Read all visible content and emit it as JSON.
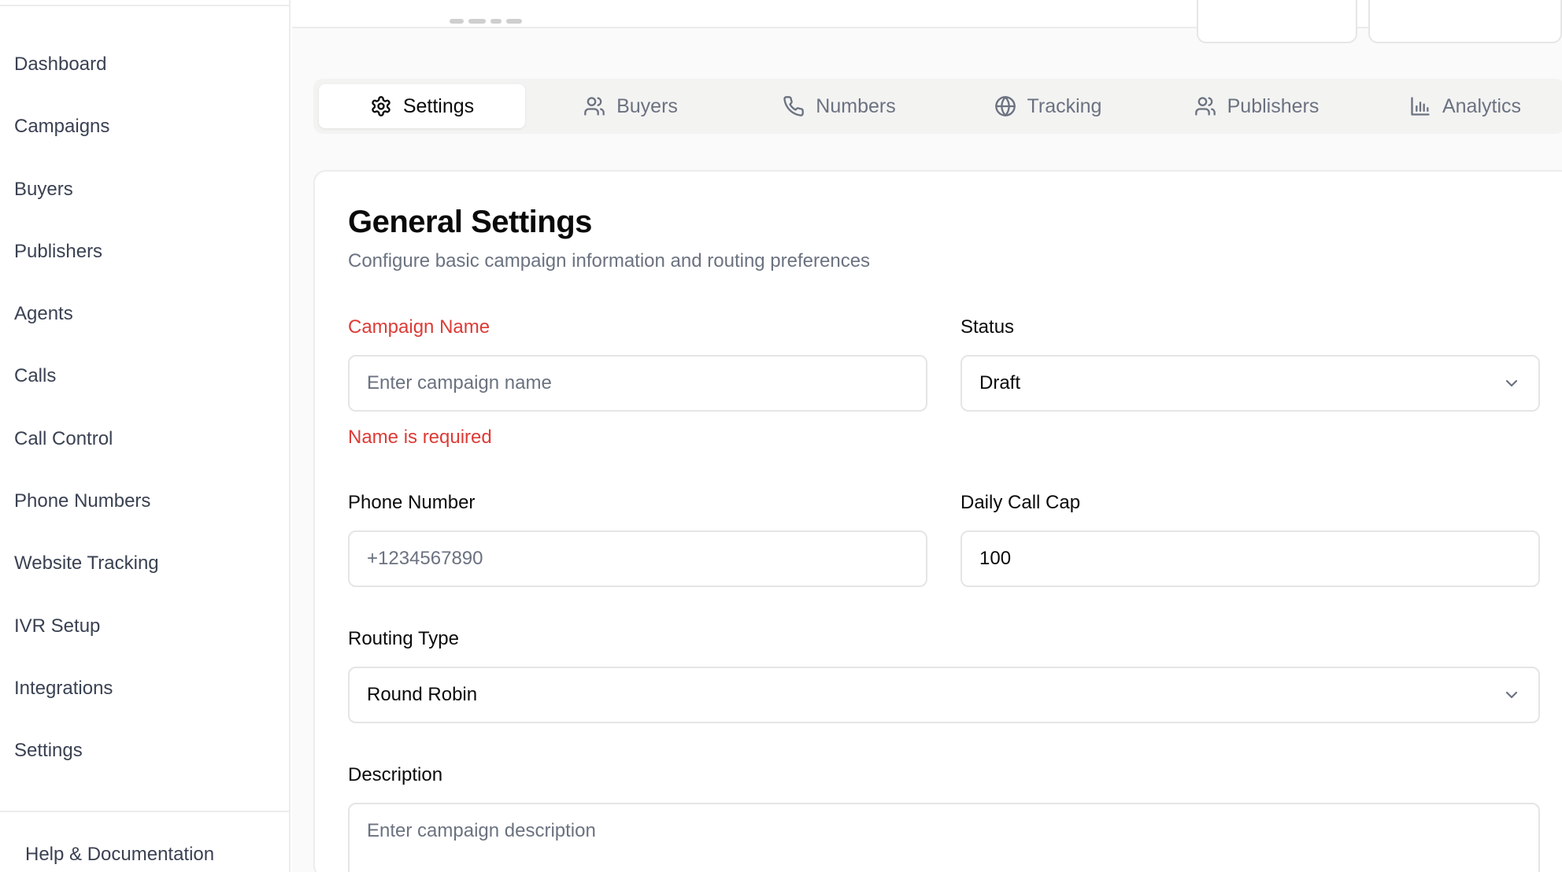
{
  "sidebar": {
    "items": [
      {
        "label": "Dashboard"
      },
      {
        "label": "Campaigns"
      },
      {
        "label": "Buyers"
      },
      {
        "label": "Publishers"
      },
      {
        "label": "Agents"
      },
      {
        "label": "Calls"
      },
      {
        "label": "Call Control"
      },
      {
        "label": "Phone Numbers"
      },
      {
        "label": "Website Tracking"
      },
      {
        "label": "IVR Setup"
      },
      {
        "label": "Integrations"
      },
      {
        "label": "Settings"
      }
    ],
    "footer_link": "Help & Documentation"
  },
  "tabs": [
    {
      "label": "Settings",
      "icon": "gear-icon",
      "active": true
    },
    {
      "label": "Buyers",
      "icon": "users-icon",
      "active": false
    },
    {
      "label": "Numbers",
      "icon": "phone-icon",
      "active": false
    },
    {
      "label": "Tracking",
      "icon": "globe-icon",
      "active": false
    },
    {
      "label": "Publishers",
      "icon": "users-icon",
      "active": false
    },
    {
      "label": "Analytics",
      "icon": "bar-chart-icon",
      "active": false
    }
  ],
  "card": {
    "title": "General Settings",
    "subtitle": "Configure basic campaign information and routing preferences"
  },
  "form": {
    "campaign_name": {
      "label": "Campaign Name",
      "value": "",
      "placeholder": "Enter campaign name",
      "error": "Name is required"
    },
    "status": {
      "label": "Status",
      "value": "Draft"
    },
    "phone_number": {
      "label": "Phone Number",
      "value": "",
      "placeholder": "+1234567890"
    },
    "daily_call_cap": {
      "label": "Daily Call Cap",
      "value": "100"
    },
    "routing_type": {
      "label": "Routing Type",
      "value": "Round Robin"
    },
    "description": {
      "label": "Description",
      "value": "",
      "placeholder": "Enter campaign description"
    }
  },
  "colors": {
    "error": "#dc3b36",
    "muted_text": "#6b7280",
    "nav_text": "#3a4152",
    "border": "#e5e5e5",
    "tab_bar": "#f3f3f2"
  }
}
